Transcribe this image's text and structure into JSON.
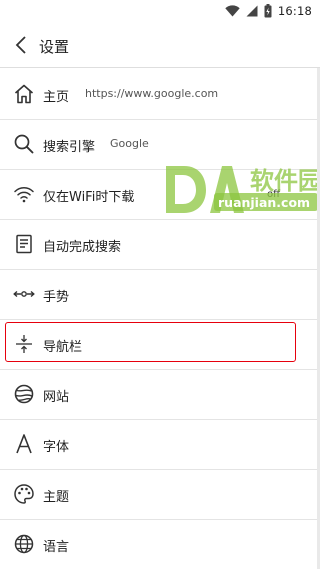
{
  "status_bar": {
    "time": "16:18"
  },
  "app_bar": {
    "title": "设置"
  },
  "settings": {
    "items": [
      {
        "label": "主页",
        "value": "https://www.google.com",
        "icon": "home-icon"
      },
      {
        "label": "搜索引擎",
        "value": "Google",
        "icon": "search-icon"
      },
      {
        "label": "仅在WiFi时下载",
        "value": "off",
        "icon": "wifi-icon"
      },
      {
        "label": "自动完成搜索",
        "value": "",
        "icon": "autocomplete-icon"
      },
      {
        "label": "手势",
        "value": "",
        "icon": "gesture-icon"
      },
      {
        "label": "导航栏",
        "value": "",
        "icon": "navbar-icon"
      },
      {
        "label": "网站",
        "value": "",
        "icon": "website-icon"
      },
      {
        "label": "字体",
        "value": "",
        "icon": "font-icon"
      },
      {
        "label": "主题",
        "value": "",
        "icon": "theme-icon"
      },
      {
        "label": "语言",
        "value": "",
        "icon": "language-icon"
      }
    ]
  },
  "watermark": {
    "brand": "DA",
    "title": "软件园",
    "domain": "ruanjian.com"
  },
  "colors": {
    "highlight": "#e6000d",
    "watermark": "#8cc63f"
  }
}
